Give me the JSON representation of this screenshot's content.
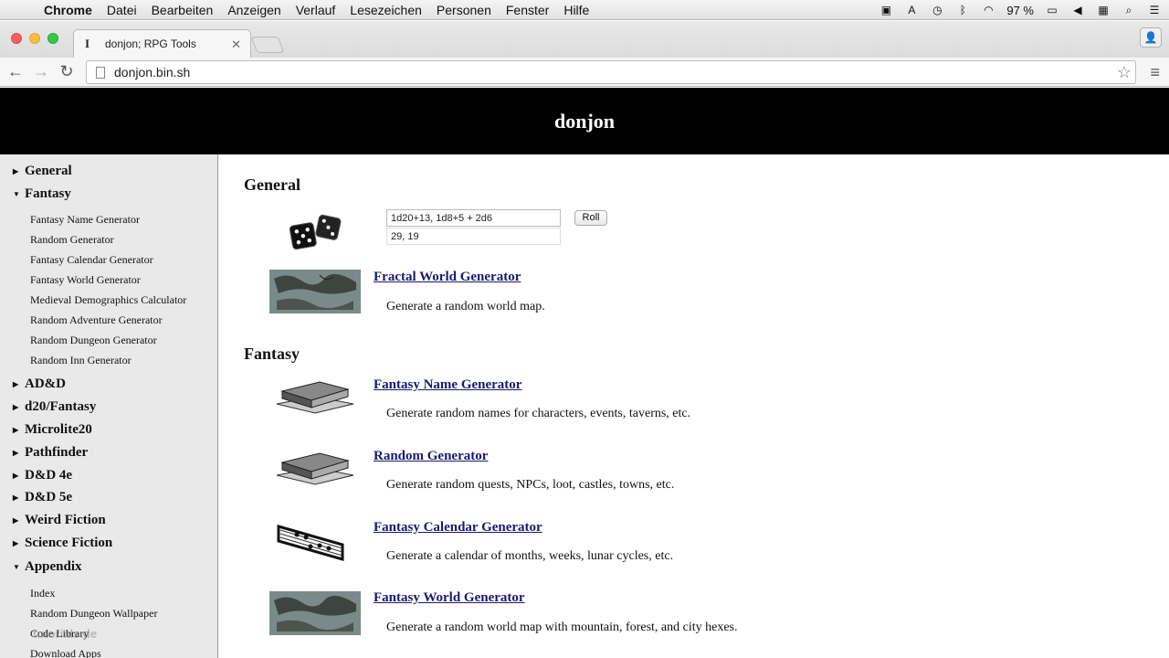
{
  "menubar": {
    "app": "Chrome",
    "items": [
      "Datei",
      "Bearbeiten",
      "Anzeigen",
      "Verlauf",
      "Lesezeichen",
      "Personen",
      "Fenster",
      "Hilfe"
    ],
    "battery": "97 %"
  },
  "browser": {
    "tab_title": "donjon; RPG Tools",
    "url": "donjon.bin.sh"
  },
  "site": {
    "title": "donjon"
  },
  "sidebar": {
    "general": "General",
    "fantasy": "Fantasy",
    "fantasy_items": [
      "Fantasy Name Generator",
      "Random Generator",
      "Fantasy Calendar Generator",
      "Fantasy World Generator",
      "Medieval Demographics Calculator",
      "Random Adventure Generator",
      "Random Dungeon Generator",
      "Random Inn Generator"
    ],
    "sections": [
      "AD&D",
      "d20/Fantasy",
      "Microlite20",
      "Pathfinder",
      "D&D 4e",
      "D&D 5e",
      "Weird Fiction",
      "Science Fiction"
    ],
    "appendix": "Appendix",
    "appendix_items": [
      "Index",
      "Random Dungeon Wallpaper",
      "Code Library",
      "Download Apps"
    ]
  },
  "main": {
    "general_heading": "General",
    "dice_input": "1d20+13, 1d8+5 + 2d6",
    "dice_output": "29, 19",
    "roll_label": "Roll",
    "fractal": {
      "link": "Fractal World Generator",
      "desc": "Generate a random world map."
    },
    "fantasy_heading": "Fantasy",
    "fantasy_items": [
      {
        "link": "Fantasy Name Generator",
        "desc": "Generate random names for characters, events, taverns, etc."
      },
      {
        "link": "Random Generator",
        "desc": "Generate random quests, NPCs, loot, castles, towns, etc."
      },
      {
        "link": "Fantasy Calendar Generator",
        "desc": "Generate a calendar of months, weeks, lunar cycles, etc."
      },
      {
        "link": "Fantasy World Generator",
        "desc": "Generate a random world map with mountain, forest, and city hexes."
      }
    ]
  },
  "watermark": "tutorials.de"
}
